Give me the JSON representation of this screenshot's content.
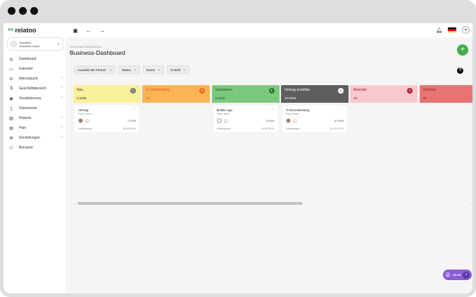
{
  "app": {
    "logo_text": "relatoo",
    "business": {
      "line1": "Business",
      "line2": "Business modul"
    }
  },
  "sidebar": {
    "items": [
      {
        "label": "Dashboard",
        "icon": "compass-icon",
        "expandable": false
      },
      {
        "label": "Kalender",
        "icon": "calendar-icon",
        "expandable": false
      },
      {
        "label": "Adressbuch",
        "icon": "phonebook-icon",
        "expandable": true
      },
      {
        "label": "Geschäftsbereich",
        "icon": "dollar-icon",
        "expandable": true
      },
      {
        "label": "Visualisierung",
        "icon": "eye-icon",
        "expandable": true
      },
      {
        "label": "Dokumente",
        "icon": "document-icon",
        "expandable": false
      },
      {
        "label": "Reports",
        "icon": "bar-chart-icon",
        "expandable": true
      },
      {
        "label": "Plan",
        "icon": "plan-calendar-icon",
        "expandable": true
      },
      {
        "label": "Einstellungen",
        "icon": "gear-icon",
        "expandable": true
      },
      {
        "label": "Benutzer",
        "icon": "users-icon",
        "expandable": false
      }
    ]
  },
  "page": {
    "breadcrumb": "GESCHÄFTSBEREICH",
    "title": "Business-Dashboard"
  },
  "filters": [
    {
      "label": "Auswahl der Partner"
    },
    {
      "label": "Status"
    },
    {
      "label": "Name"
    },
    {
      "label": "Erstellt"
    }
  ],
  "columns": [
    {
      "title": "Neu",
      "sum": "2.000€",
      "count": "1",
      "bg": "#fbf09a",
      "fg": "#333333",
      "badge": "#7a7a7a",
      "cards": [
        {
          "title": "Vertrag",
          "owner": "Peter Klein",
          "amount": "2.000€",
          "date_label": "Kaltakquise",
          "date": "19.08.2024",
          "avatar": "photo"
        }
      ]
    },
    {
      "title": "In Verhandlung",
      "sum": "0€",
      "count": "0",
      "bg": "#fbb454",
      "fg": "#e0500a",
      "badge": "#ef6a1a",
      "cards": []
    },
    {
      "title": "Gewonnen",
      "sum": "5.000€",
      "count": "1",
      "bg": "#7cc77e",
      "fg": "#1f4d20",
      "badge": "#2f7a30",
      "cards": [
        {
          "title": "Mobile App",
          "owner": "Peter Klein",
          "amount": "5.000€",
          "date_label": "Kaltakquise",
          "date": "10.06.2024",
          "avatar": "empty"
        }
      ]
    },
    {
      "title": "Vertrag erstellen",
      "sum": "10.000€",
      "count": "1",
      "bg": "#5e5e5e",
      "fg": "#ffffff",
      "badge": "#ffffff",
      "cards": [
        {
          "title": "IT-Dienstleistung",
          "owner": "Peter Klein",
          "amount": "10.000€",
          "date_label": "Kaltakquise",
          "date": "10.10.2024",
          "avatar": "photo"
        }
      ]
    },
    {
      "title": "Beendet",
      "sum": "0€",
      "count": "0",
      "bg": "#f8c9cf",
      "fg": "#a3162a",
      "badge": "#b5212f",
      "cards": []
    },
    {
      "title": "Verloren",
      "sum": "0€",
      "count": "",
      "bg": "#e87373",
      "fg": "#8a1515",
      "badge": "#8a1515",
      "cards": []
    }
  ],
  "help_widget": {
    "label": "HILFE"
  },
  "colors": {
    "accent_green": "#3fae4b",
    "help_purple": "#8b5cd6"
  }
}
